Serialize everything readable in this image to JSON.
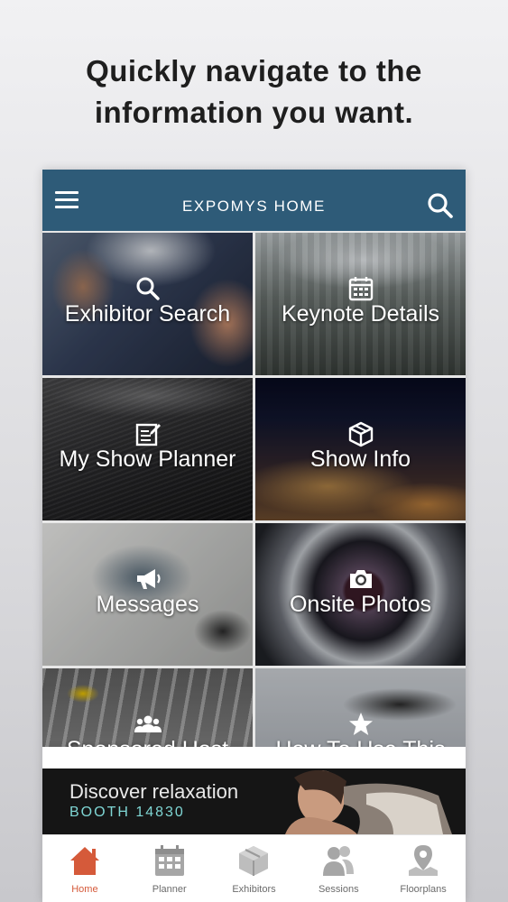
{
  "headline": "Quickly navigate to the information you want.",
  "app": {
    "title": "EXPOMYS HOME",
    "bar_color": "#2e5b78"
  },
  "tiles": [
    {
      "label": "Exhibitor Search",
      "icon": "search-icon"
    },
    {
      "label": "Keynote Details",
      "icon": "calendar-icon"
    },
    {
      "label": "My Show Planner",
      "icon": "edit-note-icon"
    },
    {
      "label": "Show Info",
      "icon": "cube-icon"
    },
    {
      "label": "Messages",
      "icon": "megaphone-icon"
    },
    {
      "label": "Onsite Photos",
      "icon": "camera-icon"
    },
    {
      "label": "Sponsored Host",
      "icon": "group-icon"
    },
    {
      "label": "How To Use This",
      "icon": "star-icon"
    }
  ],
  "ad": {
    "line1": "Discover relaxation",
    "line2": "BOOTH 14830"
  },
  "tabs": [
    {
      "label": "Home",
      "icon": "home-icon",
      "active": true
    },
    {
      "label": "Planner",
      "icon": "calendar-grid-icon",
      "active": false
    },
    {
      "label": "Exhibitors",
      "icon": "box-icon",
      "active": false
    },
    {
      "label": "Sessions",
      "icon": "people-icon",
      "active": false
    },
    {
      "label": "Floorplans",
      "icon": "map-pin-icon",
      "active": false
    }
  ],
  "colors": {
    "active_tab": "#d55a3a",
    "inactive_tab": "#9a9a9a",
    "ad_accent": "#7fd6d4"
  }
}
